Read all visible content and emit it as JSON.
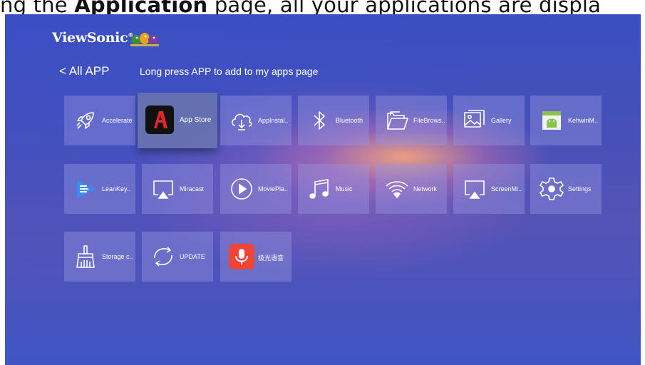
{
  "caption": {
    "pre": "ng the ",
    "bold": "Application",
    "post": " page, all your applications are displa"
  },
  "brand": {
    "logo": "ViewSonic",
    "mark": "®"
  },
  "header": {
    "back_label": "< All APP",
    "hint": "Long press APP to add to my apps page"
  },
  "apps": [
    {
      "label": "Accelerate",
      "icon": "rocket-icon"
    },
    {
      "label": "App Store",
      "icon": "app-store-icon",
      "focused": true
    },
    {
      "label": "AppInstal..",
      "icon": "cloud-download-icon"
    },
    {
      "label": "Bluetooth",
      "icon": "bluetooth-icon"
    },
    {
      "label": "FileBrows..",
      "icon": "folder-icon"
    },
    {
      "label": "Gallery",
      "icon": "gallery-icon"
    },
    {
      "label": "KehwinM..",
      "icon": "android-app-icon"
    },
    {
      "label": "LeanKey..",
      "icon": "leankey-icon"
    },
    {
      "label": "Miracast",
      "icon": "cast-icon"
    },
    {
      "label": "MoviePla..",
      "icon": "play-icon"
    },
    {
      "label": "Music",
      "icon": "music-note-icon"
    },
    {
      "label": "Network",
      "icon": "wifi-icon"
    },
    {
      "label": "ScreenMi..",
      "icon": "screen-mirror-icon"
    },
    {
      "label": "Settings",
      "icon": "gear-icon"
    },
    {
      "label": "Storage c..",
      "icon": "broom-icon"
    },
    {
      "label": "UPDATE",
      "icon": "refresh-icon"
    },
    {
      "label": "极光语音",
      "icon": "microphone-icon"
    }
  ],
  "colors": {
    "app_store_red": "#e4232b",
    "voice_red": "#f04436",
    "leankey_blue": "#3b8cf2",
    "android_green": "#8bc34a"
  }
}
